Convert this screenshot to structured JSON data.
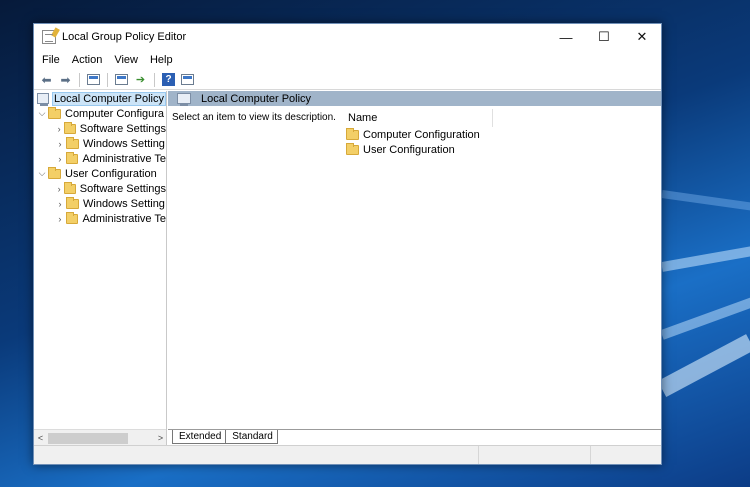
{
  "window": {
    "title": "Local Group Policy Editor",
    "minimize": "—",
    "maximize": "☐",
    "close": "✕"
  },
  "menu": [
    "File",
    "Action",
    "View",
    "Help"
  ],
  "tree": {
    "root": "Local Computer Policy",
    "computer": "Computer Configura",
    "computer_children": [
      "Software Settings",
      "Windows Setting",
      "Administrative Te"
    ],
    "user": "User Configuration",
    "user_children": [
      "Software Settings",
      "Windows Setting",
      "Administrative Te"
    ]
  },
  "content": {
    "header": "Local Computer Policy",
    "description": "Select an item to view its description.",
    "column_name": "Name",
    "items": [
      "Computer Configuration",
      "User Configuration"
    ]
  },
  "tabs": [
    "Extended",
    "Standard"
  ],
  "icons": {
    "back": "back-arrow-icon",
    "forward": "forward-arrow-icon",
    "folder": "folder-icon",
    "computer": "computer-policy-icon",
    "help": "help-icon"
  },
  "colors": {
    "header_bar": "#a0b4c9",
    "selection": "#cce4f7",
    "folder": "#f3cf67"
  }
}
